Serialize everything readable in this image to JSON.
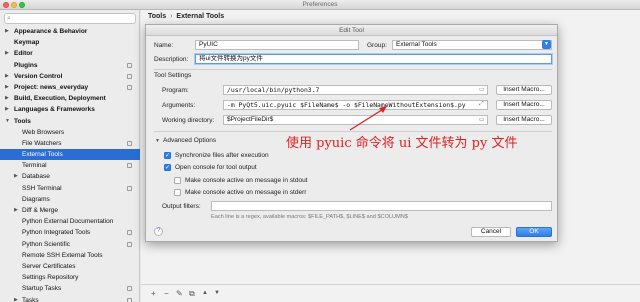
{
  "window": {
    "title": "Preferences"
  },
  "sidebar": {
    "items": [
      {
        "label": "Appearance & Behavior",
        "level": 0,
        "bold": true,
        "arrow": "▶",
        "selected": false,
        "tag": false
      },
      {
        "label": "Keymap",
        "level": 0,
        "bold": true,
        "arrow": "",
        "selected": false,
        "tag": false
      },
      {
        "label": "Editor",
        "level": 0,
        "bold": true,
        "arrow": "▶",
        "selected": false,
        "tag": false
      },
      {
        "label": "Plugins",
        "level": 0,
        "bold": true,
        "arrow": "",
        "selected": false,
        "tag": true
      },
      {
        "label": "Version Control",
        "level": 0,
        "bold": true,
        "arrow": "▶",
        "selected": false,
        "tag": true
      },
      {
        "label": "Project: news_everyday",
        "level": 0,
        "bold": true,
        "arrow": "▶",
        "selected": false,
        "tag": true
      },
      {
        "label": "Build, Execution, Deployment",
        "level": 0,
        "bold": true,
        "arrow": "▶",
        "selected": false,
        "tag": false
      },
      {
        "label": "Languages & Frameworks",
        "level": 0,
        "bold": true,
        "arrow": "▶",
        "selected": false,
        "tag": false
      },
      {
        "label": "Tools",
        "level": 0,
        "bold": true,
        "arrow": "▼",
        "selected": false,
        "tag": false
      },
      {
        "label": "Web Browsers",
        "level": 1,
        "bold": false,
        "arrow": "",
        "selected": false,
        "tag": false
      },
      {
        "label": "File Watchers",
        "level": 1,
        "bold": false,
        "arrow": "",
        "selected": false,
        "tag": true
      },
      {
        "label": "External Tools",
        "level": 1,
        "bold": false,
        "arrow": "",
        "selected": true,
        "tag": false
      },
      {
        "label": "Terminal",
        "level": 1,
        "bold": false,
        "arrow": "",
        "selected": false,
        "tag": true
      },
      {
        "label": "Database",
        "level": 1,
        "bold": false,
        "arrow": "▶",
        "selected": false,
        "tag": false
      },
      {
        "label": "SSH Terminal",
        "level": 1,
        "bold": false,
        "arrow": "",
        "selected": false,
        "tag": true
      },
      {
        "label": "Diagrams",
        "level": 1,
        "bold": false,
        "arrow": "",
        "selected": false,
        "tag": false
      },
      {
        "label": "Diff & Merge",
        "level": 1,
        "bold": false,
        "arrow": "▶",
        "selected": false,
        "tag": false
      },
      {
        "label": "Python External Documentation",
        "level": 1,
        "bold": false,
        "arrow": "",
        "selected": false,
        "tag": false
      },
      {
        "label": "Python Integrated Tools",
        "level": 1,
        "bold": false,
        "arrow": "",
        "selected": false,
        "tag": true
      },
      {
        "label": "Python Scientific",
        "level": 1,
        "bold": false,
        "arrow": "",
        "selected": false,
        "tag": true
      },
      {
        "label": "Remote SSH External Tools",
        "level": 1,
        "bold": false,
        "arrow": "",
        "selected": false,
        "tag": false
      },
      {
        "label": "Server Certificates",
        "level": 1,
        "bold": false,
        "arrow": "",
        "selected": false,
        "tag": false
      },
      {
        "label": "Settings Repository",
        "level": 1,
        "bold": false,
        "arrow": "",
        "selected": false,
        "tag": false
      },
      {
        "label": "Startup Tasks",
        "level": 1,
        "bold": false,
        "arrow": "",
        "selected": false,
        "tag": true
      },
      {
        "label": "Tasks",
        "level": 1,
        "bold": false,
        "arrow": "▶",
        "selected": false,
        "tag": true
      }
    ]
  },
  "breadcrumb": {
    "root": "Tools",
    "separator": "›",
    "current": "External Tools"
  },
  "bottom_toolbar": {
    "add": "+",
    "remove": "−",
    "edit": "✎",
    "copy": "⧉",
    "up": "▲",
    "down": "▼"
  },
  "dialog": {
    "title": "Edit Tool",
    "name_label": "Name:",
    "name_value": "PyUIC",
    "group_label": "Group:",
    "group_value": "External Tools",
    "description_label": "Description:",
    "description_value": "将ui文件转换为py文件",
    "tool_settings_header": "Tool Settings",
    "program_label": "Program:",
    "program_value": "/usr/local/bin/python3.7",
    "arguments_label": "Arguments:",
    "arguments_value": "-m PyQt5.uic.pyuic $FileName$ -o $FileNameWithoutExtension$.py",
    "working_dir_label": "Working directory:",
    "working_dir_value": "$ProjectFileDir$",
    "insert_macro_label": "Insert Macro...",
    "advanced_header": "Advanced Options",
    "advanced_arrow": "▼",
    "sync_files_label": "Synchronize files after execution",
    "open_console_label": "Open console for tool output",
    "stdout_label": "Make console active on message in stdout",
    "stderr_label": "Make console active on message in stderr",
    "output_filters_label": "Output filters:",
    "output_filters_hint": "Each line is a regex, available macros: $FILE_PATH$, $LINE$ and $COLUMN$",
    "help_label": "?",
    "cancel_label": "Cancel",
    "ok_label": "OK",
    "checks": {
      "sync": true,
      "console": true,
      "stdout": false,
      "stderr": false
    }
  },
  "annotation": {
    "text": "使用 pyuic 命令将 ui 文件转为 py 文件",
    "color": "#e0211f"
  },
  "colors": {
    "selection": "#2a6ed5",
    "accent": "#2f7fe9"
  }
}
